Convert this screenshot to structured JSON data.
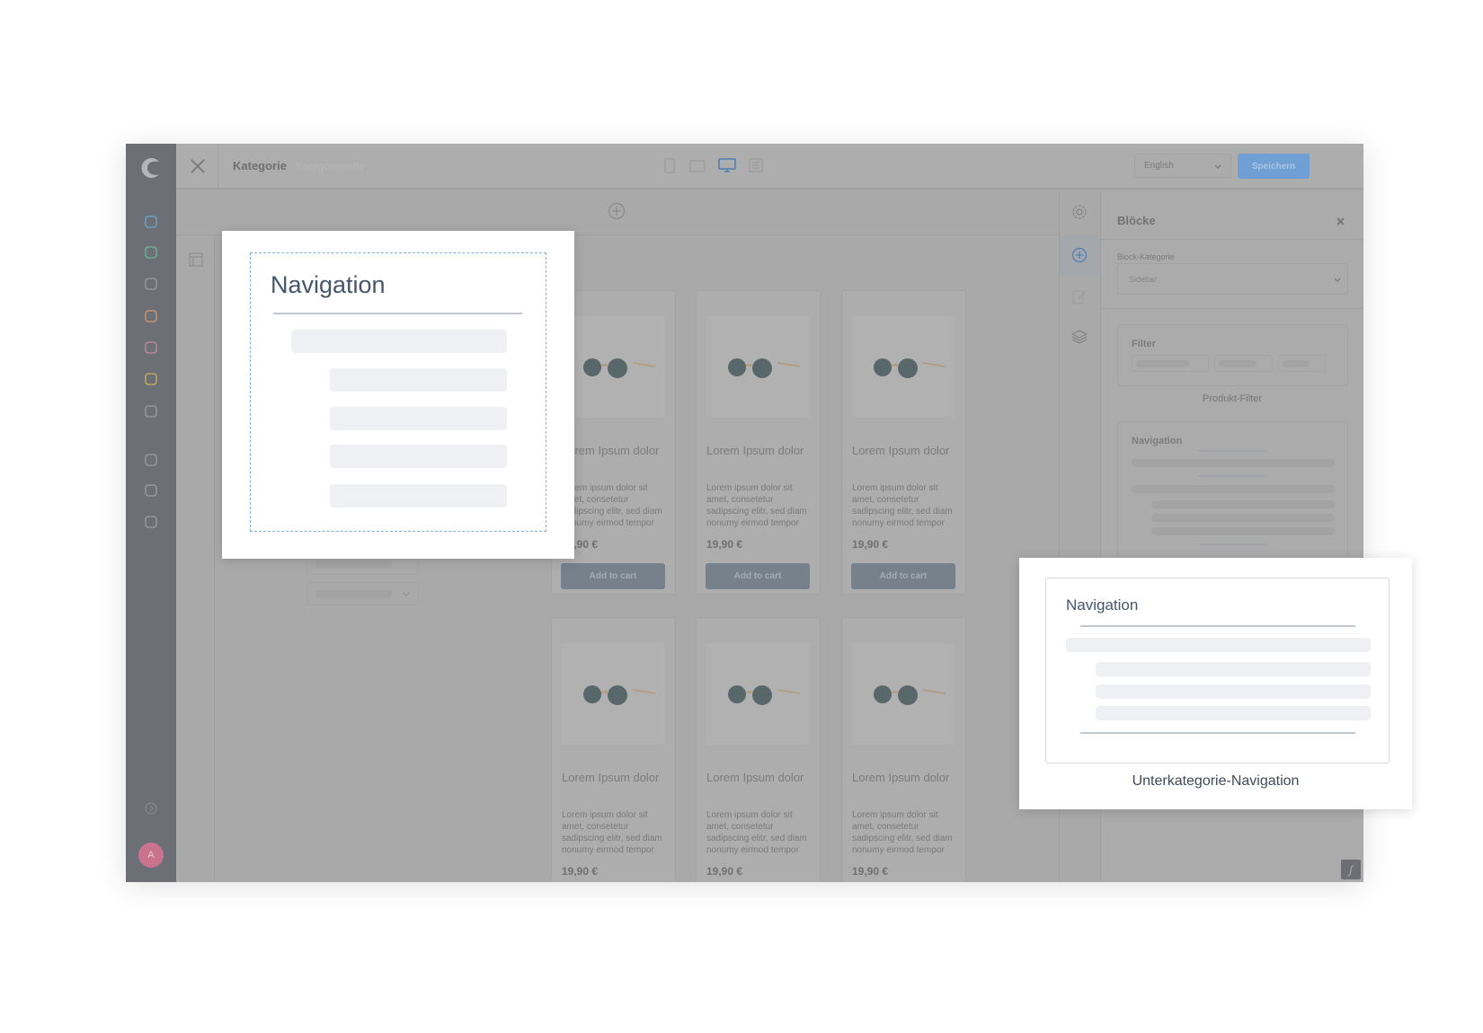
{
  "app": {
    "logo": "shopware-logo"
  },
  "sidebar": {
    "icons": [
      {
        "name": "dashboard-icon",
        "color": "#6fa6c9"
      },
      {
        "name": "products-icon",
        "color": "#6fb59a"
      },
      {
        "name": "orders-icon",
        "color": "#9a9ea6"
      },
      {
        "name": "customers-icon",
        "color": "#d49a73"
      },
      {
        "name": "content-icon",
        "color": "#c98aa5"
      },
      {
        "name": "marketing-icon",
        "color": "#c9b45a"
      },
      {
        "name": "settings-icon",
        "color": "#9a9ea6"
      },
      {
        "name": "add-extension-icon",
        "color": "#9a9ea6"
      },
      {
        "name": "basket-icon",
        "color": "#9a9ea6"
      },
      {
        "name": "store-icon",
        "color": "#9a9ea6"
      }
    ],
    "collapse_icon": "chevron-circle-icon",
    "avatar": {
      "initial": "A",
      "color": "#c9738f"
    }
  },
  "header": {
    "title": "Kategorie",
    "subtitle": "Kategorieseite",
    "language": "English",
    "save_label": "Speichern",
    "accent": "#6f9fd4"
  },
  "cards": [
    {
      "title": "Lorem Ipsum dolor",
      "desc": "Lorem ipsum dolor sit amet, consetetur sadipscing elitr, sed diam nonumy eirmod tempor",
      "price": "19,90 €",
      "button": "Add to cart"
    },
    {
      "title": "Lorem Ipsum dolor",
      "desc": "Lorem ipsum dolor sit amet, consetetur sadipscing elitr, sed diam nonumy eirmod tempor",
      "price": "19,90 €",
      "button": "Add to cart"
    },
    {
      "title": "Lorem Ipsum dolor",
      "desc": "Lorem ipsum dolor sit amet, consetetur sadipscing elitr, sed diam nonumy eirmod tempor",
      "price": "19,90 €",
      "button": "Add to cart"
    },
    {
      "title": "Lorem Ipsum dolor",
      "desc": "Lorem ipsum dolor sit amet, consetetur sadipscing elitr, sed diam nonumy eirmod tempor",
      "price": "19,90 €"
    },
    {
      "title": "Lorem Ipsum dolor",
      "desc": "Lorem ipsum dolor sit amet, consetetur sadipscing elitr, sed diam nonumy eirmod tempor",
      "price": "19,90 €"
    },
    {
      "title": "Lorem Ipsum dolor",
      "desc": "Lorem ipsum dolor sit amet, consetetur sadipscing elitr, sed diam nonumy eirmod tempor",
      "price": "19,90 €"
    }
  ],
  "panel": {
    "title": "Blöcke",
    "category_label": "Block-Kategorie",
    "category_value": "Sidebar",
    "filter_title": "Filter",
    "filter_caption": "Produkt-Filter",
    "nav_title": "Navigation"
  },
  "popup_left": {
    "title": "Navigation"
  },
  "popup_right": {
    "title": "Navigation",
    "caption": "Unterkategorie-Navigation"
  }
}
